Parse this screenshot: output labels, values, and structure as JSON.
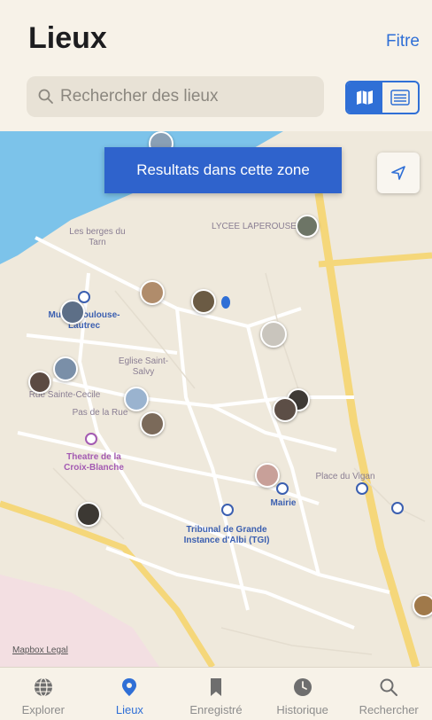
{
  "header": {
    "title": "Lieux",
    "filter_label": "Fitre"
  },
  "search": {
    "placeholder": "Rechercher des lieux"
  },
  "view_toggle": {
    "active": "map",
    "options": [
      "map",
      "list"
    ]
  },
  "map": {
    "banner": "Resultats dans cette zone",
    "labels": {
      "lycee": "LYCEE LAPEROUSE",
      "berges": "Les berges du Tarn",
      "musee": "Musee Toulouse-Lautrec",
      "eglise": "Eglise Saint-Salvy",
      "carrer": "Rue Sainte-Cecile",
      "pont": "Pas de la Rue",
      "theatre": "Theatre de la Croix-Blanche",
      "vigan": "Place du Vigan",
      "mairie": "Mairie",
      "tribunal": "Tribunal de Grande Instance d'Albi (TGI)",
      "attribution": "Mapbox Legal"
    },
    "colors": {
      "river": "#7cc3ea",
      "road": "#f5d77a",
      "banner": "#2f63cc"
    }
  },
  "tabbar": {
    "items": [
      {
        "label": "Explorer",
        "icon": "globe-icon",
        "active": false
      },
      {
        "label": "Lieux",
        "icon": "map-pin-icon",
        "active": true
      },
      {
        "label": "Enregistré",
        "icon": "bookmark-icon",
        "active": false
      },
      {
        "label": "Historique",
        "icon": "clock-icon",
        "active": false
      },
      {
        "label": "Rechercher",
        "icon": "search-icon",
        "active": false
      }
    ]
  },
  "accent_color": "#2f6fd6"
}
